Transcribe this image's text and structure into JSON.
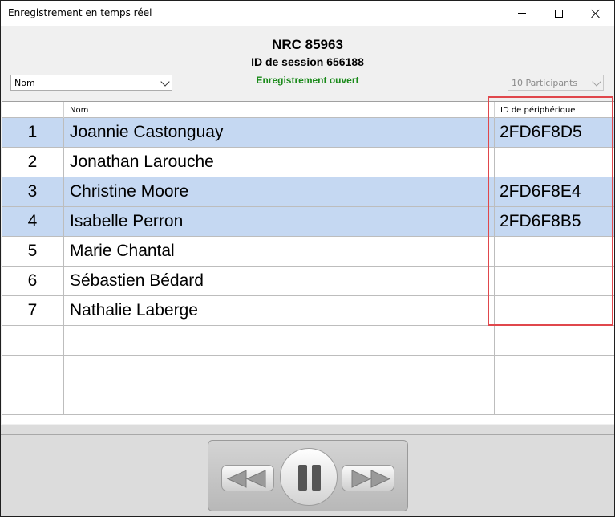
{
  "window": {
    "title": "Enregistrement en temps réel"
  },
  "header": {
    "nrc": "NRC 85963",
    "session": "ID de session 656188",
    "status": "Enregistrement ouvert",
    "status_color": "#1a8a1a"
  },
  "sort_select": {
    "value": "Nom"
  },
  "participants_select": {
    "value": "10 Participants"
  },
  "table": {
    "columns": [
      "",
      "Nom",
      "ID de périphérique"
    ],
    "rows": [
      {
        "num": "1",
        "name": "Joannie Castonguay",
        "device": "2FD6F8D5",
        "selected": true
      },
      {
        "num": "2",
        "name": "Jonathan Larouche",
        "device": "",
        "selected": false
      },
      {
        "num": "3",
        "name": "Christine Moore",
        "device": "2FD6F8E4",
        "selected": true
      },
      {
        "num": "4",
        "name": "Isabelle Perron",
        "device": "2FD6F8B5",
        "selected": true
      },
      {
        "num": "5",
        "name": "Marie Chantal",
        "device": "",
        "selected": false
      },
      {
        "num": "6",
        "name": "Sébastien Bédard",
        "device": "",
        "selected": false
      },
      {
        "num": "7",
        "name": "Nathalie Laberge",
        "device": "",
        "selected": false
      },
      {
        "num": "",
        "name": "",
        "device": "",
        "selected": false
      },
      {
        "num": "",
        "name": "",
        "device": "",
        "selected": false
      },
      {
        "num": "",
        "name": "",
        "device": "",
        "selected": false
      }
    ],
    "selected_color": "#c5d8f2",
    "highlight_color": "#e0474c"
  },
  "controls": {
    "icons": [
      "rewind-icon",
      "pause-icon",
      "fast-forward-icon"
    ]
  }
}
